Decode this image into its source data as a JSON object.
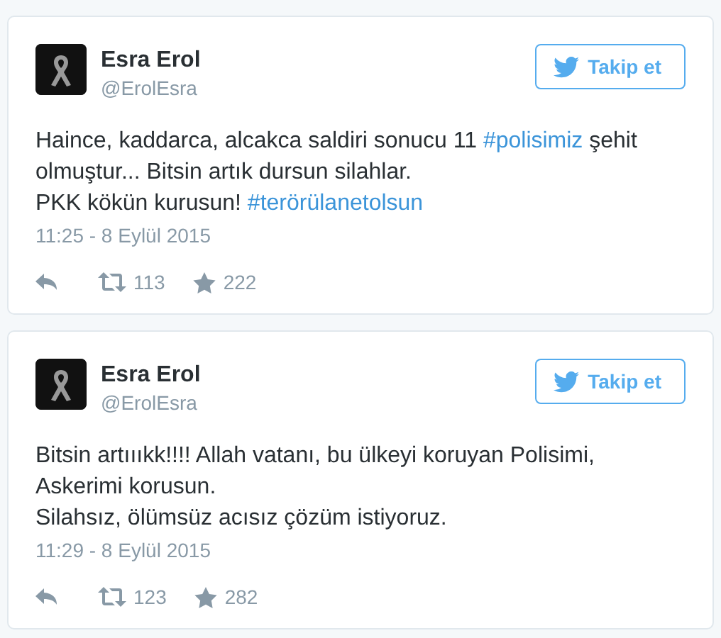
{
  "tweets": [
    {
      "name": "Esra Erol",
      "handle": "@ErolEsra",
      "follow_label": "Takip et",
      "paragraphs": [
        [
          {
            "kind": "text",
            "text": "Haince, kaddarca, alcakca saldiri sonucu 11 "
          },
          {
            "kind": "hashtag",
            "text": "#polisimiz"
          },
          {
            "kind": "text",
            "text": " şehit olmuştur... Bitsin artık dursun silahlar."
          }
        ],
        [
          {
            "kind": "text",
            "text": "PKK kökün kurusun! "
          },
          {
            "kind": "hashtag",
            "text": "#terörülanetolsun"
          }
        ]
      ],
      "time": "11:25 - 8 Eylül 2015",
      "retweets": "113",
      "likes": "222"
    },
    {
      "name": "Esra Erol",
      "handle": "@ErolEsra",
      "follow_label": "Takip et",
      "paragraphs": [
        [
          {
            "kind": "text",
            "text": "Bitsin artıııkk!!!! Allah vatanı, bu ülkeyi koruyan Polisimi, Askerimi korusun."
          }
        ],
        [
          {
            "kind": "text",
            "text": "Silahsız, ölümsüz acısız çözüm istiyoruz."
          }
        ]
      ],
      "time": "11:29 - 8 Eylül 2015",
      "retweets": "123",
      "likes": "282"
    }
  ]
}
